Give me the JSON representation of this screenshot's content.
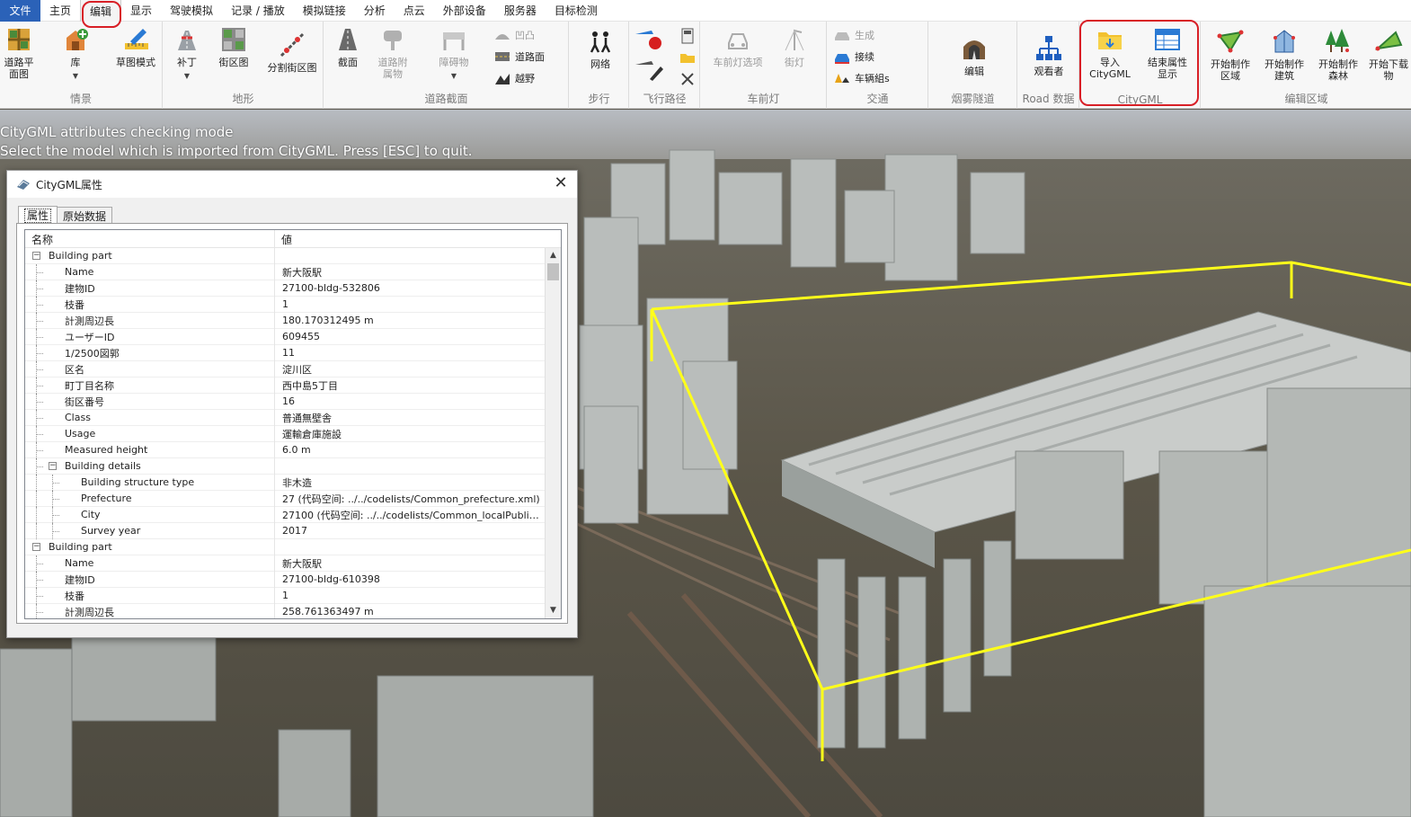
{
  "menu": {
    "items": [
      "文件",
      "主页",
      "编辑",
      "显示",
      "驾驶模拟",
      "记录 / 播放",
      "模拟链接",
      "分析",
      "点云",
      "外部设备",
      "服务器",
      "目标检测"
    ],
    "active_index": 2
  },
  "ribbon": {
    "groups": {
      "info": {
        "label": "情景",
        "road_plan": "道路平\n面图",
        "library": "库",
        "draft_mode": "草图模式"
      },
      "terrain": {
        "label": "地形",
        "patch": "补丁",
        "street_block": "街区图",
        "split_block": "分割街区图"
      },
      "road_section": {
        "label": "道路截面",
        "section": "截面",
        "road_attach": "道路附\n属物",
        "obstacle": "障碍物",
        "bump": "凹凸",
        "road_surface": "道路面",
        "offroad": "越野"
      },
      "walk": {
        "label": "步行",
        "network": "网络"
      },
      "flight": {
        "label": "飞行路径"
      },
      "headlight": {
        "label": "车前灯",
        "options": "车前灯选项",
        "streetlight": "街灯"
      },
      "traffic": {
        "label": "交通",
        "generate": "生成",
        "connect": "接续",
        "vehicle_group": "车辆組s"
      },
      "fog": {
        "label": "烟雾隧道",
        "edit": "编辑"
      },
      "road_data": {
        "label": "Road 数据",
        "viewer": "观看者"
      },
      "citygml": {
        "label": "CityGML",
        "import": "导入\nCityGML",
        "end_attr": "结束属性\n显示"
      },
      "edit_area": {
        "label": "编辑区域",
        "start_area": "开始制作\n区域",
        "start_building": "开始制作\n建筑",
        "start_forest": "开始制作\n森林",
        "start_next": "开始下载\n物"
      }
    }
  },
  "mode_text": {
    "line1": "CityGML attributes checking mode",
    "line2": "Select the model which is imported from CityGML. Press [ESC] to quit."
  },
  "dialog": {
    "title": "CityGML属性",
    "close": "✕",
    "tabs": [
      "属性",
      "原始数据"
    ],
    "columns": {
      "name": "名称",
      "value": "値"
    },
    "rows": [
      {
        "level": 0,
        "toggle": "−",
        "name": "Building part",
        "value": ""
      },
      {
        "level": 1,
        "name": "Name",
        "value": "新大阪駅"
      },
      {
        "level": 1,
        "name": "建物ID",
        "value": "27100-bldg-532806"
      },
      {
        "level": 1,
        "name": "枝番",
        "value": "1"
      },
      {
        "level": 1,
        "name": "計測周辺長",
        "value": "180.170312495 m"
      },
      {
        "level": 1,
        "name": "ユーザーID",
        "value": "609455"
      },
      {
        "level": 1,
        "name": "1/2500図郭",
        "value": "11"
      },
      {
        "level": 1,
        "name": "区名",
        "value": "淀川区"
      },
      {
        "level": 1,
        "name": "町丁目名称",
        "value": "西中島5丁目"
      },
      {
        "level": 1,
        "name": "街区番号",
        "value": "16"
      },
      {
        "level": 1,
        "name": "Class",
        "value": "普通無壁舎"
      },
      {
        "level": 1,
        "name": "Usage",
        "value": "運輸倉庫施設"
      },
      {
        "level": 1,
        "name": "Measured height",
        "value": "6.0 m"
      },
      {
        "level": 1,
        "toggle": "−",
        "name": "Building details",
        "value": ""
      },
      {
        "level": 2,
        "name": "Building structure type",
        "value": "非木造"
      },
      {
        "level": 2,
        "name": "Prefecture",
        "value": "27 (代码空间: ../../codelists/Common_prefecture.xml)"
      },
      {
        "level": 2,
        "name": "City",
        "value": "27100 (代码空间: ../../codelists/Common_localPublicAut..."
      },
      {
        "level": 2,
        "name": "Survey year",
        "value": "2017"
      },
      {
        "level": 0,
        "toggle": "−",
        "name": "Building part",
        "value": ""
      },
      {
        "level": 1,
        "name": "Name",
        "value": "新大阪駅"
      },
      {
        "level": 1,
        "name": "建物ID",
        "value": "27100-bldg-610398"
      },
      {
        "level": 1,
        "name": "枝番",
        "value": "1"
      },
      {
        "level": 1,
        "name": "計測周辺長",
        "value": "258.761363497 m"
      }
    ]
  },
  "colors": {
    "file_menu": "#2b62b8",
    "highlight": "#d81f26",
    "selection_box": "#ffff1a"
  }
}
